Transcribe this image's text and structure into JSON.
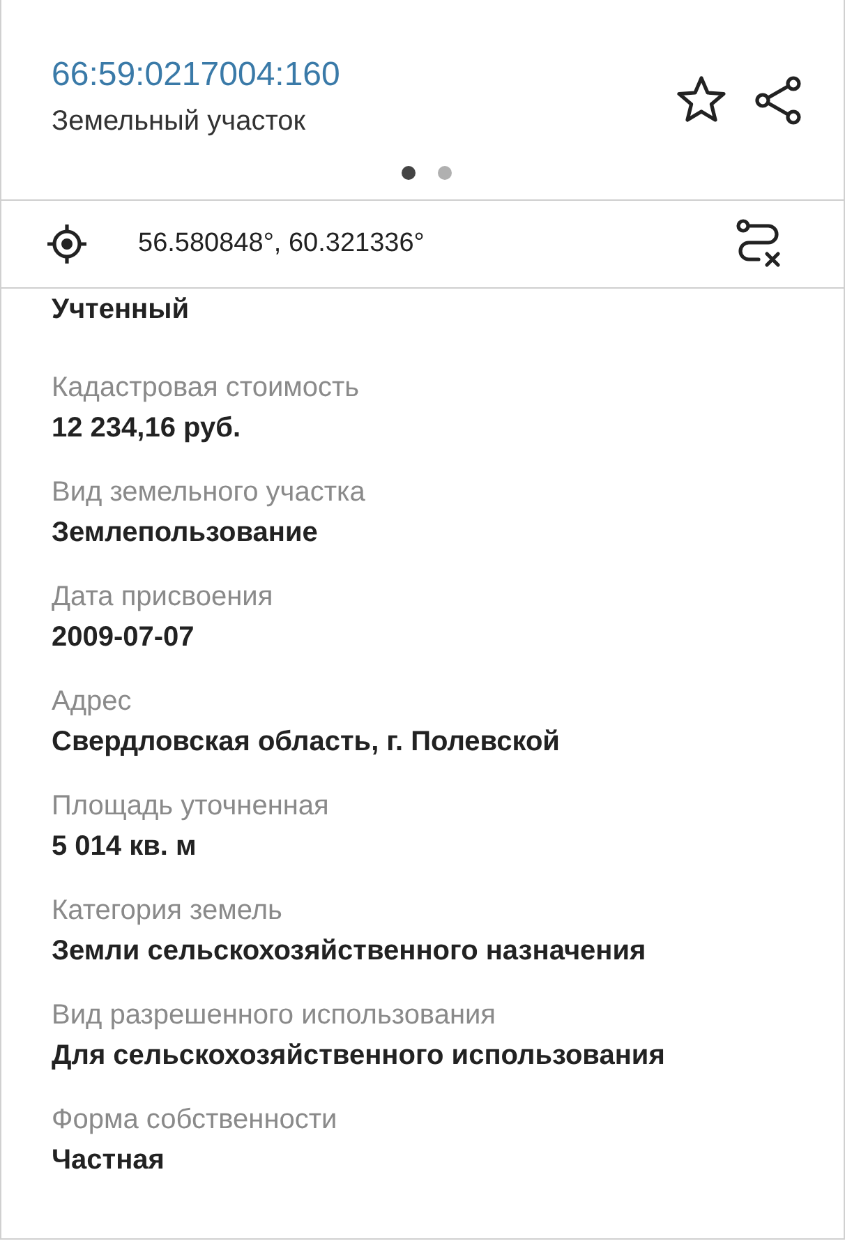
{
  "header": {
    "title": "66:59:0217004:160",
    "subtitle": "Земельный участок"
  },
  "pager": [
    {
      "selected": true
    },
    {
      "selected": false
    }
  ],
  "coordinates": "56.580848°, 60.321336°",
  "fields": [
    {
      "value": "Учтенный"
    },
    {
      "label": "Кадастровая стоимость",
      "value": "12 234,16 руб."
    },
    {
      "label": "Вид земельного участка",
      "value": "Землепользование"
    },
    {
      "label": "Дата присвоения",
      "value": "2009-07-07"
    },
    {
      "label": "Адрес",
      "value": "Свердловская область, г. Полевской"
    },
    {
      "label": "Площадь уточненная",
      "value": "5 014 кв. м"
    },
    {
      "label": "Категория земель",
      "value": "Земли сельскохозяйственного назначения"
    },
    {
      "label": "Вид разрешенного использования",
      "value": "Для сельскохозяйственного использования"
    },
    {
      "label": "Форма собственности",
      "value": "Частная"
    }
  ]
}
